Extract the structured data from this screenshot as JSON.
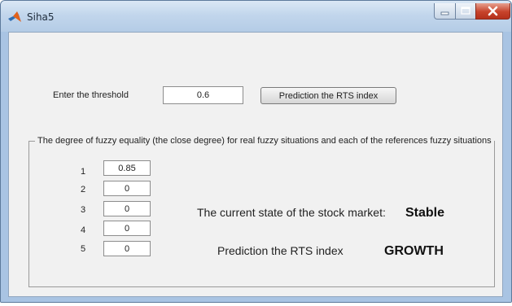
{
  "window": {
    "title": "Siha5",
    "colors": {
      "titlebar": "#c2d6ec",
      "close_button": "#c7432b",
      "panel": "#f1f1f1"
    }
  },
  "threshold": {
    "label": "Enter the threshold",
    "value": "0.6",
    "button_label": "Prediction the RTS index"
  },
  "group": {
    "title": "The degree of fuzzy equality (the close degree) for real fuzzy situations and each of the references fuzzy situations",
    "rows": [
      {
        "index": "1",
        "value": "0.85"
      },
      {
        "index": "2",
        "value": "0"
      },
      {
        "index": "3",
        "value": "0"
      },
      {
        "index": "4",
        "value": "0"
      },
      {
        "index": "5",
        "value": "0"
      }
    ]
  },
  "state": {
    "label": "The current state of the stock market:",
    "value": "Stable"
  },
  "prediction": {
    "label": "Prediction the RTS index",
    "value": "GROWTH"
  },
  "icons": [
    "matlab-icon",
    "minimize-icon",
    "maximize-icon",
    "close-icon"
  ]
}
